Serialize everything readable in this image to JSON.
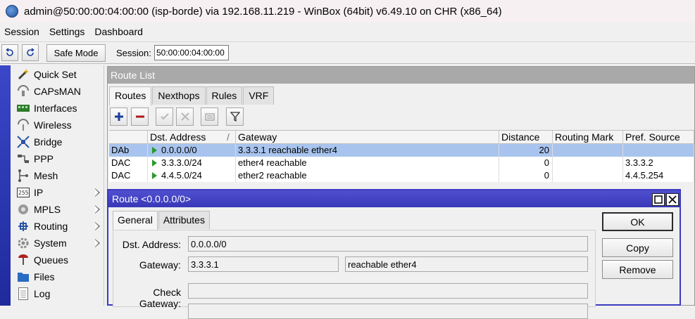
{
  "window": {
    "title": "admin@50:00:00:04:00:00 (isp-borde) via 192.168.11.219 - WinBox (64bit) v6.49.10 on CHR (x86_64)"
  },
  "menu": {
    "items": [
      "Session",
      "Settings",
      "Dashboard"
    ]
  },
  "toolbar": {
    "safe_mode_label": "Safe Mode",
    "session_label": "Session:",
    "session_value": "50:00:00:04:00:00"
  },
  "sidebar": {
    "items": [
      {
        "label": "Quick Set",
        "icon": "wand-icon"
      },
      {
        "label": "CAPsMAN",
        "icon": "capsman-icon"
      },
      {
        "label": "Interfaces",
        "icon": "interfaces-icon"
      },
      {
        "label": "Wireless",
        "icon": "wireless-icon"
      },
      {
        "label": "Bridge",
        "icon": "bridge-icon"
      },
      {
        "label": "PPP",
        "icon": "ppp-icon"
      },
      {
        "label": "Mesh",
        "icon": "mesh-icon"
      },
      {
        "label": "IP",
        "icon": "ip-icon",
        "submenu": true
      },
      {
        "label": "MPLS",
        "icon": "mpls-icon",
        "submenu": true
      },
      {
        "label": "Routing",
        "icon": "routing-icon",
        "submenu": true
      },
      {
        "label": "System",
        "icon": "system-icon",
        "submenu": true
      },
      {
        "label": "Queues",
        "icon": "queues-icon"
      },
      {
        "label": "Files",
        "icon": "files-icon"
      },
      {
        "label": "Log",
        "icon": "log-icon"
      }
    ]
  },
  "route_list": {
    "title": "Route List",
    "tabs": [
      "Routes",
      "Nexthops",
      "Rules",
      "VRF"
    ],
    "columns": [
      "",
      "Dst. Address",
      "Gateway",
      "Distance",
      "Routing Mark",
      "Pref. Source"
    ],
    "sort_indicator": "/",
    "rows": [
      {
        "flags": "DAb",
        "dst": "0.0.0.0/0",
        "gateway": "3.3.3.1 reachable ether4",
        "distance": "20",
        "routing_mark": "",
        "pref_source": "",
        "selected": true
      },
      {
        "flags": "DAC",
        "dst": "3.3.3.0/24",
        "gateway": "ether4 reachable",
        "distance": "0",
        "routing_mark": "",
        "pref_source": "3.3.3.2",
        "selected": false
      },
      {
        "flags": "DAC",
        "dst": "4.4.5.0/24",
        "gateway": "ether2 reachable",
        "distance": "0",
        "routing_mark": "",
        "pref_source": "4.4.5.254",
        "selected": false
      }
    ]
  },
  "route_dialog": {
    "title": "Route <0.0.0.0/0>",
    "tabs": [
      "General",
      "Attributes"
    ],
    "dst_label": "Dst. Address:",
    "dst_value": "0.0.0.0/0",
    "gateway_label": "Gateway:",
    "gateway_value": "3.3.3.1",
    "gateway_status": "reachable ether4",
    "check_gateway_label": "Check Gateway:",
    "check_gateway_value": "",
    "buttons": {
      "ok": "OK",
      "copy": "Copy",
      "remove": "Remove"
    }
  },
  "colors": {
    "selected_row": "#a8c4ee",
    "dialog_title": "#3838b8",
    "sidebar_strip": "#2a37b8"
  }
}
